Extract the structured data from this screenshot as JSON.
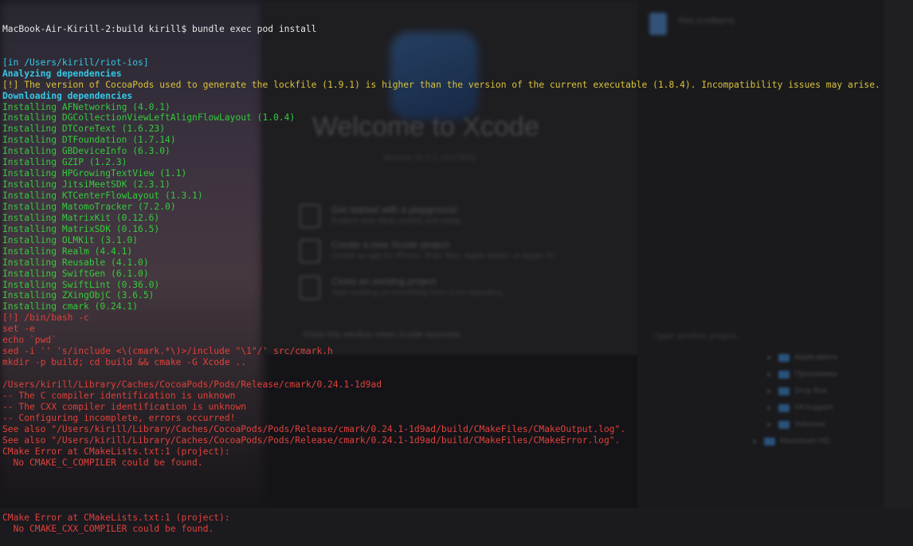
{
  "background": {
    "xcode_title": "Welcome to Xcode",
    "xcode_version": "Version 11.3.1 (11C505)",
    "xcode_items": [
      {
        "title": "Get started with a playground",
        "subtitle": "Explore new ideas quickly and easily."
      },
      {
        "title": "Create a new Xcode project",
        "subtitle": "Create an app for iPhone, iPad, Mac, Apple Watch, or Apple TV."
      },
      {
        "title": "Clone an existing project",
        "subtitle": "Start working on something from a Git repository."
      }
    ],
    "xcode_checkbox": "Show this window when Xcode launches",
    "xcode_open_other": "Open another project...",
    "recent_file": "Riot.xcodeproj",
    "folders": [
      "Applications",
      "Программы",
      "Drop Box",
      "VKSupport",
      "Volumes",
      "Macintosh HD"
    ]
  },
  "terminal": {
    "prompt": "MacBook-Air-Kirill-2:build kirill$ bundle exec pod install",
    "lines": [
      {
        "text": "[in /Users/kirill/riot-ios]",
        "color": "cyan"
      },
      {
        "text": "Analyzing dependencies",
        "color": "cyan-bold"
      },
      {
        "text": "[!] The version of CocoaPods used to generate the lockfile (1.9.1) is higher than the version of the current executable (1.8.4). Incompatibility issues may arise.",
        "color": "yellow"
      },
      {
        "text": "Downloading dependencies",
        "color": "cyan-bold"
      },
      {
        "text": "Installing AFNetworking (4.0.1)",
        "color": "green"
      },
      {
        "text": "Installing DGCollectionViewLeftAlignFlowLayout (1.0.4)",
        "color": "green"
      },
      {
        "text": "Installing DTCoreText (1.6.23)",
        "color": "green"
      },
      {
        "text": "Installing DTFoundation (1.7.14)",
        "color": "green"
      },
      {
        "text": "Installing GBDeviceInfo (6.3.0)",
        "color": "green"
      },
      {
        "text": "Installing GZIP (1.2.3)",
        "color": "green"
      },
      {
        "text": "Installing HPGrowingTextView (1.1)",
        "color": "green"
      },
      {
        "text": "Installing JitsiMeetSDK (2.3.1)",
        "color": "green"
      },
      {
        "text": "Installing KTCenterFlowLayout (1.3.1)",
        "color": "green"
      },
      {
        "text": "Installing MatomoTracker (7.2.0)",
        "color": "green"
      },
      {
        "text": "Installing MatrixKit (0.12.6)",
        "color": "green"
      },
      {
        "text": "Installing MatrixSDK (0.16.5)",
        "color": "green"
      },
      {
        "text": "Installing OLMKit (3.1.0)",
        "color": "green"
      },
      {
        "text": "Installing Realm (4.4.1)",
        "color": "green"
      },
      {
        "text": "Installing Reusable (4.1.0)",
        "color": "green"
      },
      {
        "text": "Installing SwiftGen (6.1.0)",
        "color": "green"
      },
      {
        "text": "Installing SwiftLint (0.36.0)",
        "color": "green"
      },
      {
        "text": "Installing ZXingObjC (3.6.5)",
        "color": "green"
      },
      {
        "text": "Installing cmark (0.24.1)",
        "color": "green"
      },
      {
        "text": "[!] /bin/bash -c",
        "color": "red"
      },
      {
        "text": "set -e",
        "color": "red"
      },
      {
        "text": "echo `pwd`",
        "color": "red"
      },
      {
        "text": "sed -i '' 's/include <\\(cmark.*\\)>/include \"\\1\"/' src/cmark.h",
        "color": "red"
      },
      {
        "text": "mkdir -p build; cd build && cmake -G Xcode ..",
        "color": "red"
      },
      {
        "text": "",
        "color": "red"
      },
      {
        "text": "/Users/kirill/Library/Caches/CocoaPods/Pods/Release/cmark/0.24.1-1d9ad",
        "color": "red"
      },
      {
        "text": "-- The C compiler identification is unknown",
        "color": "red"
      },
      {
        "text": "-- The CXX compiler identification is unknown",
        "color": "red"
      },
      {
        "text": "-- Configuring incomplete, errors occurred!",
        "color": "red"
      },
      {
        "text": "See also \"/Users/kirill/Library/Caches/CocoaPods/Pods/Release/cmark/0.24.1-1d9ad/build/CMakeFiles/CMakeOutput.log\".",
        "color": "red"
      },
      {
        "text": "See also \"/Users/kirill/Library/Caches/CocoaPods/Pods/Release/cmark/0.24.1-1d9ad/build/CMakeFiles/CMakeError.log\".",
        "color": "red"
      },
      {
        "text": "CMake Error at CMakeLists.txt:1 (project):",
        "color": "red"
      },
      {
        "text": "  No CMAKE_C_COMPILER could be found.",
        "color": "red"
      },
      {
        "text": "",
        "color": "red"
      },
      {
        "text": "",
        "color": "red"
      },
      {
        "text": "",
        "color": "red"
      },
      {
        "text": "",
        "color": "red"
      },
      {
        "text": "CMake Error at CMakeLists.txt:1 (project):",
        "color": "red"
      },
      {
        "text": "  No CMAKE_CXX_COMPILER could be found.",
        "color": "red"
      }
    ]
  }
}
